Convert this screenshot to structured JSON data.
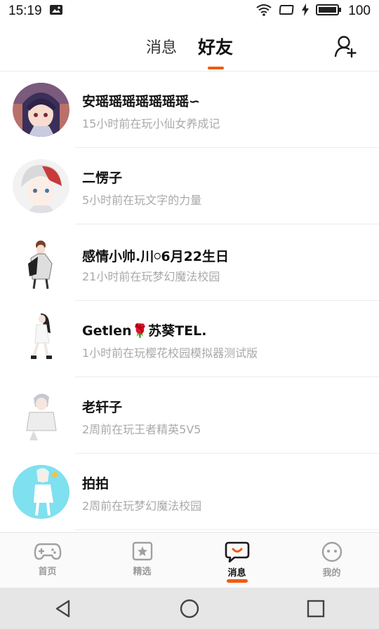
{
  "status_bar": {
    "time": "15:19",
    "battery": "100"
  },
  "header": {
    "tabs": [
      {
        "label": "消息",
        "active": false
      },
      {
        "label": "好友",
        "active": true
      }
    ],
    "accent_color": "#f25a12"
  },
  "friends": [
    {
      "name": "安瑶瑶瑶瑶瑶瑶瑶∽",
      "status": "15小时前在玩小仙女养成记"
    },
    {
      "name": "二愣子",
      "status": "5小时前在玩文字的力量"
    },
    {
      "name": "感情小帅.川𓏸6月22生日",
      "status": "21小时前在玩梦幻魔法校园"
    },
    {
      "name": "Getlen🌹苏葵TEL.",
      "status": "1小时前在玩樱花校园模拟器测试版"
    },
    {
      "name": "老轩子",
      "status": "2周前在玩王者精英5V5"
    },
    {
      "name": "拍拍",
      "status": "2周前在玩梦幻魔法校园"
    }
  ],
  "bottom_nav": [
    {
      "label": "首页",
      "icon": "gamepad-icon"
    },
    {
      "label": "精选",
      "icon": "star-card-icon"
    },
    {
      "label": "消息",
      "icon": "chat-bubble-icon",
      "active": true
    },
    {
      "label": "我的",
      "icon": "face-icon"
    }
  ]
}
